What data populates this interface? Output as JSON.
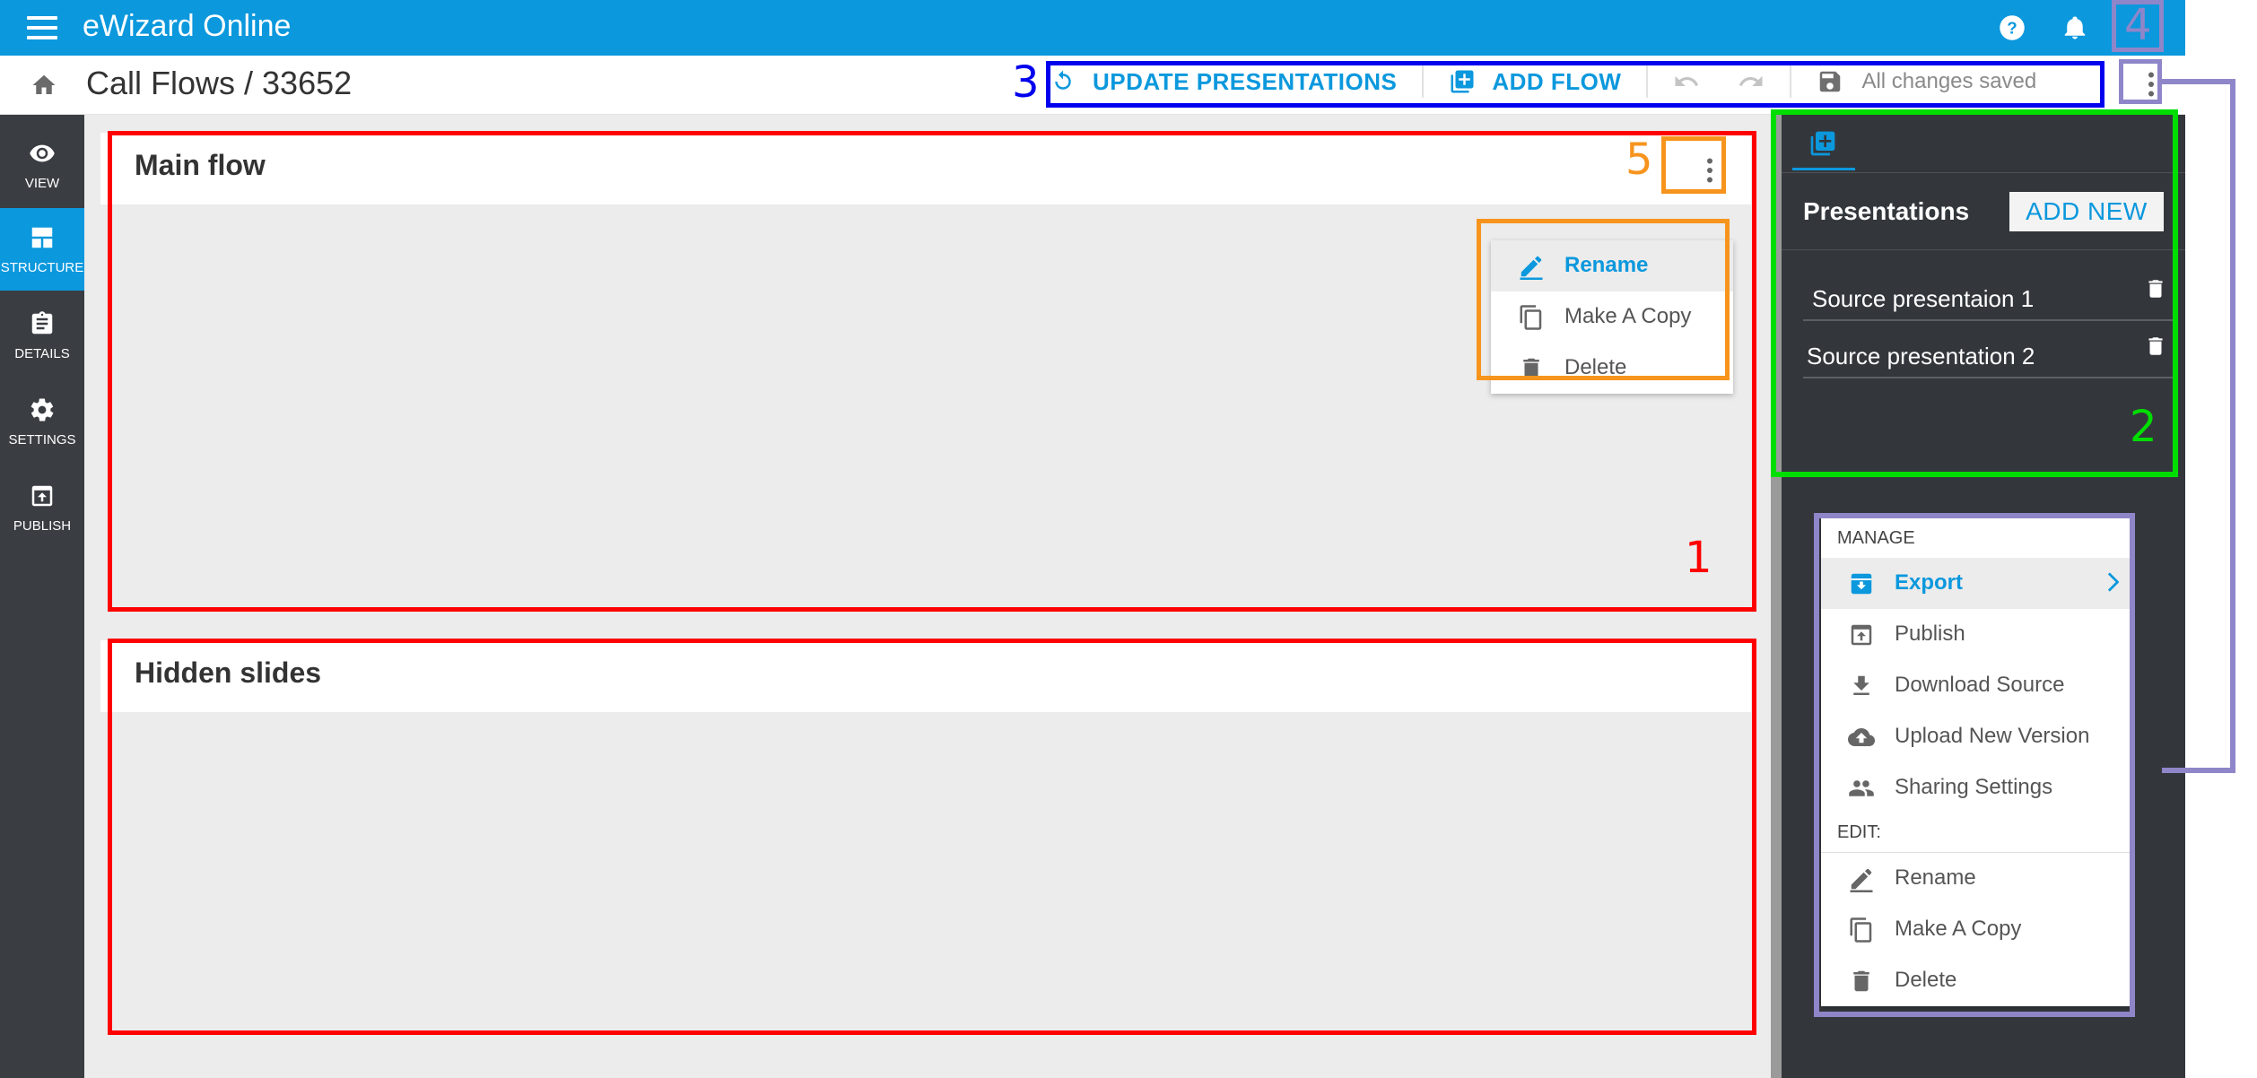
{
  "app": {
    "title": "eWizard Online"
  },
  "breadcrumb": {
    "title": "Call Flows / 33652"
  },
  "toolbar": {
    "update_label": "UPDATE PRESENTATIONS",
    "add_flow_label": "ADD FLOW",
    "saved_status": "All changes saved"
  },
  "nav": {
    "items": [
      {
        "label": "VIEW",
        "icon": "eye-icon"
      },
      {
        "label": "STRUCTURE",
        "icon": "structure-icon",
        "active": true
      },
      {
        "label": "DETAILS",
        "icon": "clipboard-icon"
      },
      {
        "label": "SETTINGS",
        "icon": "gear-icon"
      },
      {
        "label": "PUBLISH",
        "icon": "publish-icon"
      }
    ]
  },
  "flows": [
    {
      "title": "Main flow"
    },
    {
      "title": "Hidden slides"
    }
  ],
  "flow_menu": {
    "items": [
      {
        "label": "Rename",
        "icon": "pencil-icon",
        "active": true
      },
      {
        "label": "Make A Copy",
        "icon": "copy-icon"
      },
      {
        "label": "Delete",
        "icon": "trash-icon"
      }
    ]
  },
  "panel": {
    "title": "Presentations",
    "add_new_label": "ADD NEW",
    "presentations": [
      {
        "label": "Source presentaion 1"
      },
      {
        "label": "Source presentation 2"
      }
    ]
  },
  "manage_menu": {
    "manage_heading": "MANAGE",
    "edit_heading": "EDIT:",
    "manage_items": [
      {
        "label": "Export",
        "icon": "export-icon",
        "active": true
      },
      {
        "label": "Publish",
        "icon": "publish-icon"
      },
      {
        "label": "Download Source",
        "icon": "download-icon"
      },
      {
        "label": "Upload New Version",
        "icon": "cloud-upload-icon"
      },
      {
        "label": "Sharing Settings",
        "icon": "people-icon"
      }
    ],
    "edit_items": [
      {
        "label": "Rename",
        "icon": "pencil-icon"
      },
      {
        "label": "Make A Copy",
        "icon": "copy-icon"
      },
      {
        "label": "Delete",
        "icon": "trash-icon"
      }
    ]
  },
  "annotations": {
    "labels": [
      "1",
      "2",
      "3",
      "4",
      "5"
    ],
    "colors": {
      "1": "#ff0000",
      "2": "#00dd00",
      "3": "#0000ee",
      "4": "#8f86c9",
      "5": "#f7941d"
    }
  },
  "colors": {
    "brand": "#0b98dd",
    "sidebar": "#3a3d42",
    "panel": "#33373c",
    "canvas": "#ececec"
  }
}
